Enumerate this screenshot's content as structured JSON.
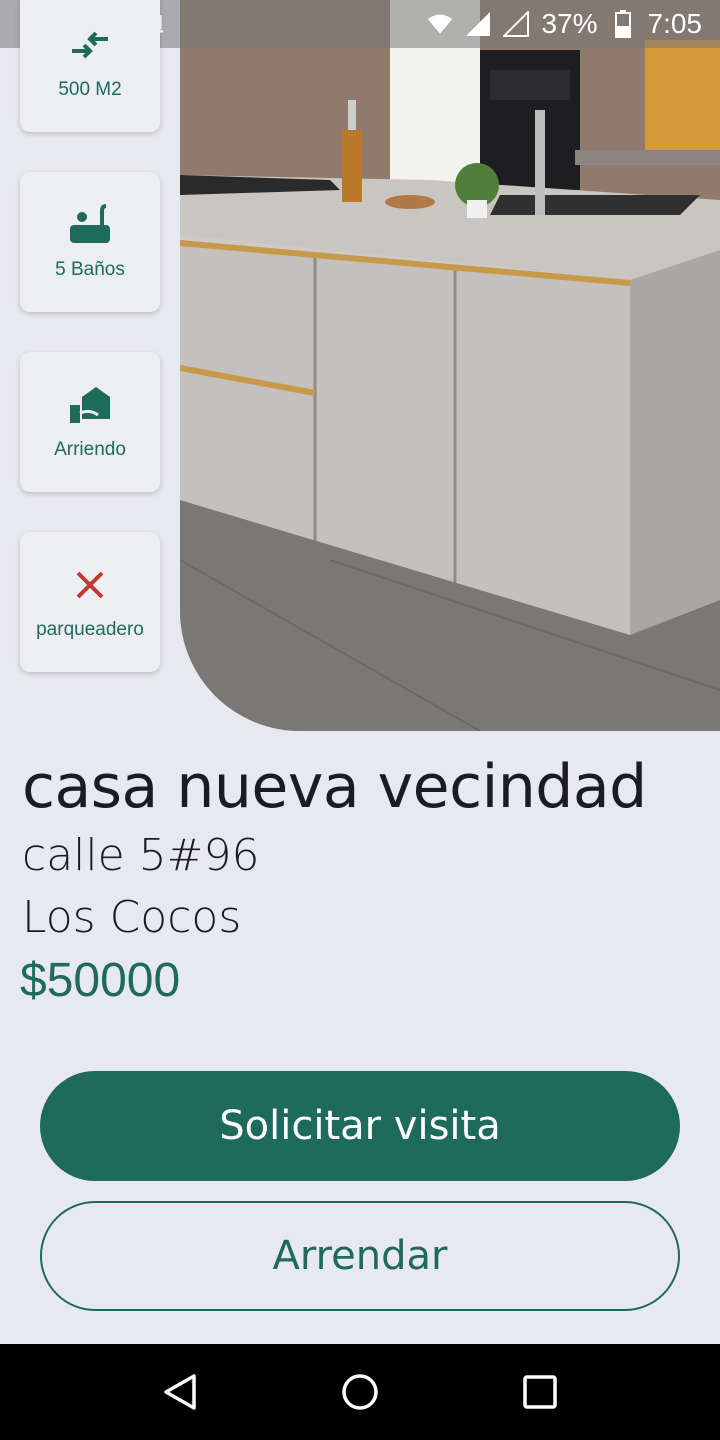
{
  "status_bar": {
    "battery": "37%",
    "time": "7:05",
    "icons": [
      "music-note-icon",
      "image-icon",
      "record-icon",
      "laptop-icon",
      "wifi-icon",
      "signal-icon",
      "battery-icon"
    ]
  },
  "features": [
    {
      "icon": "area-arrows-icon",
      "label": "500 M2"
    },
    {
      "icon": "bathtub-icon",
      "label": "5 Baños"
    },
    {
      "icon": "rent-hand-house-icon",
      "label": "Arriendo"
    },
    {
      "icon": "close-x-icon",
      "label": "parqueadero"
    }
  ],
  "property": {
    "title": "casa nueva vecindad",
    "address": "calle 5#96",
    "neighborhood": "Los Cocos",
    "price": "$50000"
  },
  "actions": {
    "primary_label": "Solicitar visita",
    "secondary_label": "Arrendar"
  },
  "colors": {
    "accent": "#1e6b5c",
    "background": "#e8e9ee",
    "danger": "#c0392b"
  },
  "nav": [
    "back-icon",
    "home-icon",
    "recents-icon"
  ]
}
